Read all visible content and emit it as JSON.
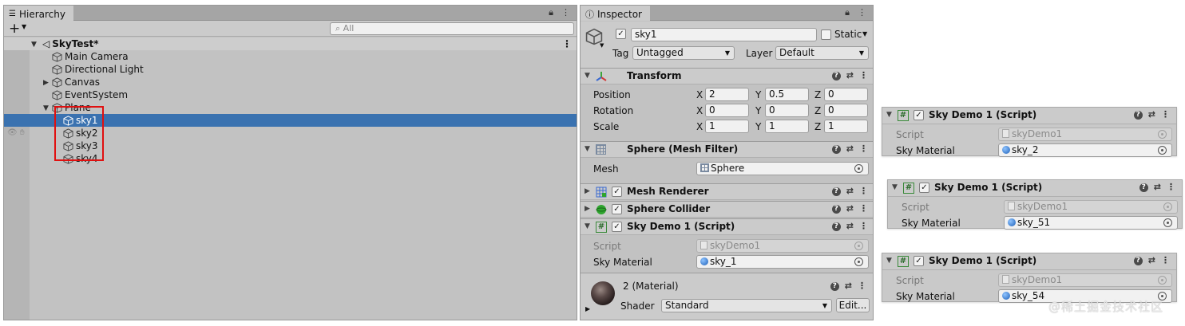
{
  "hierarchy": {
    "tab_label": "Hierarchy",
    "add_label": "+",
    "search_placeholder": "All",
    "scene_name": "SkyTest*",
    "items": [
      {
        "label": "Main Camera",
        "expandable": false
      },
      {
        "label": "Directional Light",
        "expandable": false
      },
      {
        "label": "Canvas",
        "expandable": true
      },
      {
        "label": "EventSystem",
        "expandable": false
      },
      {
        "label": "Plane",
        "expandable": true,
        "expanded": true
      },
      {
        "label": "sky1",
        "selected": true
      },
      {
        "label": "sky2"
      },
      {
        "label": "sky3"
      },
      {
        "label": "sky4"
      }
    ]
  },
  "inspector": {
    "tab_label": "Inspector",
    "object_name": "sky1",
    "static_label": "Static",
    "tag_label": "Tag",
    "tag_value": "Untagged",
    "layer_label": "Layer",
    "layer_value": "Default",
    "transform": {
      "title": "Transform",
      "position_label": "Position",
      "rotation_label": "Rotation",
      "scale_label": "Scale",
      "position": {
        "x": "2",
        "y": "0.5",
        "z": "0"
      },
      "rotation": {
        "x": "0",
        "y": "0",
        "z": "0"
      },
      "scale": {
        "x": "1",
        "y": "1",
        "z": "1"
      },
      "axis_x": "X",
      "axis_y": "Y",
      "axis_z": "Z"
    },
    "mesh_filter": {
      "title": "Sphere (Mesh Filter)",
      "mesh_label": "Mesh",
      "mesh_value": "Sphere"
    },
    "mesh_renderer": {
      "title": "Mesh Renderer"
    },
    "sphere_collider": {
      "title": "Sphere Collider"
    },
    "sky_demo": {
      "title": "Sky Demo 1 (Script)",
      "script_label": "Script",
      "script_value": "skyDemo1",
      "material_label": "Sky Material",
      "material_value": "sky_1"
    },
    "material": {
      "title": "2 (Material)",
      "shader_label": "Shader",
      "shader_value": "Standard",
      "edit_label": "Edit..."
    }
  },
  "side_panels": [
    {
      "title": "Sky Demo 1 (Script)",
      "script_label": "Script",
      "script_value": "skyDemo1",
      "material_label": "Sky Material",
      "material_value": "sky_2"
    },
    {
      "title": "Sky Demo 1 (Script)",
      "script_label": "Script",
      "script_value": "skyDemo1",
      "material_label": "Sky Material",
      "material_value": "sky_51"
    },
    {
      "title": "Sky Demo 1 (Script)",
      "script_label": "Script",
      "script_value": "skyDemo1",
      "material_label": "Sky Material",
      "material_value": "sky_54"
    }
  ],
  "watermark": "@稀土掘金技术社区",
  "colors": {
    "selection": "#3a72b0",
    "highlight": "#e01010",
    "panel": "#c2c2c2"
  }
}
